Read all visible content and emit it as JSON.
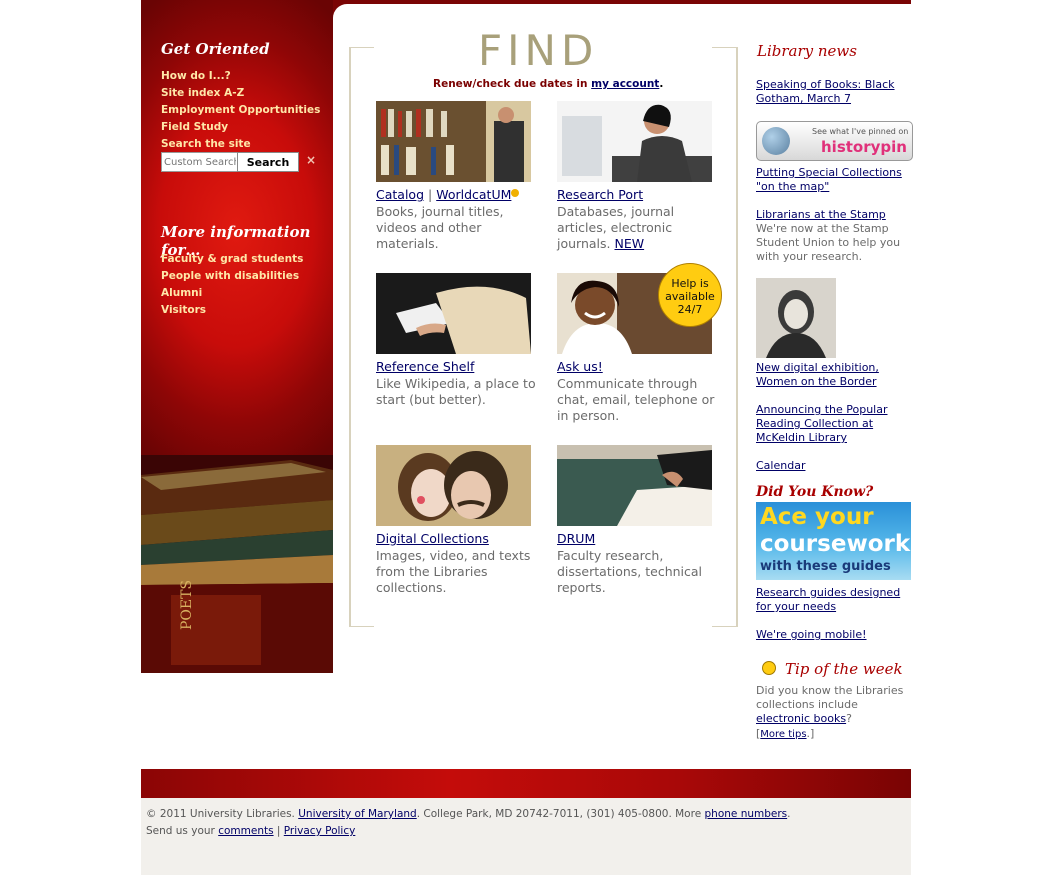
{
  "sidebar": {
    "get_oriented": "Get Oriented",
    "nav": [
      "How do I...?",
      "Site index A-Z",
      "Employment Opportunities",
      "Field Study",
      "Search the site"
    ],
    "search_placeholder": "Custom Search",
    "search_button": "Search",
    "clear": "×",
    "more_info": "More information for…",
    "audiences": [
      "Faculty & grad students",
      "People with disabilities",
      "Alumni",
      "Visitors"
    ]
  },
  "find": {
    "title": "FIND",
    "renew_prefix": "Renew/check due dates in ",
    "renew_link": "my account",
    "renew_suffix": ".",
    "tiles": [
      {
        "title": "Catalog",
        "title2": "WorldcatUM",
        "sep": "|",
        "desc": "Books, journal titles, videos and other materials."
      },
      {
        "title": "Research Port",
        "desc": "Databases, journal articles, electronic journals.",
        "badge": "NEW"
      },
      {
        "title": "Reference Shelf",
        "desc": "Like Wikipedia, a place to start (but better)."
      },
      {
        "title": "Ask us!",
        "desc": "Communicate through chat, email, telephone or in person.",
        "bubble": [
          "Help is",
          "available",
          "24/7"
        ]
      },
      {
        "title": "Digital Collections",
        "desc": "Images, video, and texts from the Libraries collections."
      },
      {
        "title": "DRUM",
        "desc": "Faculty research, dissertations, technical reports."
      }
    ]
  },
  "news": {
    "heading": "Library news",
    "item1": "Speaking of Books: Black Gotham, March 7",
    "pin_banner_top": "See what I've pinned on",
    "pin_banner_logo": "historypin",
    "item2": "Putting Special Collections \"on the map\"",
    "item3": "Librarians at the Stamp",
    "item3_desc": "We're now at the Stamp Student Union to help you with your research.",
    "item4": "New digital exhibition, Women on the Border",
    "item5": "Announcing the Popular Reading Collection at McKeldin Library",
    "item6": "Calendar"
  },
  "did_you_know": {
    "heading": "Did You Know?",
    "banner_line1": "Ace your",
    "banner_line2": "coursework",
    "banner_line3": "with these guides",
    "link": "Research guides designed for your needs",
    "mobile": "We're going mobile!"
  },
  "tip": {
    "heading": "Tip of the week",
    "text": "Did you know the Libraries collections include",
    "link": "electronic books",
    "after": "?",
    "more_open": "[",
    "more": "More tips",
    "more_close": ".]"
  },
  "footer": {
    "copyright": "© 2011 University Libraries. ",
    "umd": "University of Maryland",
    "address": ". College Park, MD 20742-7011, (301) 405-0800. More ",
    "phone": "phone numbers",
    "end": ".",
    "send": "Send us your ",
    "comments": "comments",
    "sep": " | ",
    "privacy": "Privacy Policy"
  },
  "colors": {
    "brand_red": "#c80c0a",
    "link": "#000066",
    "heading_red": "#a80000"
  }
}
